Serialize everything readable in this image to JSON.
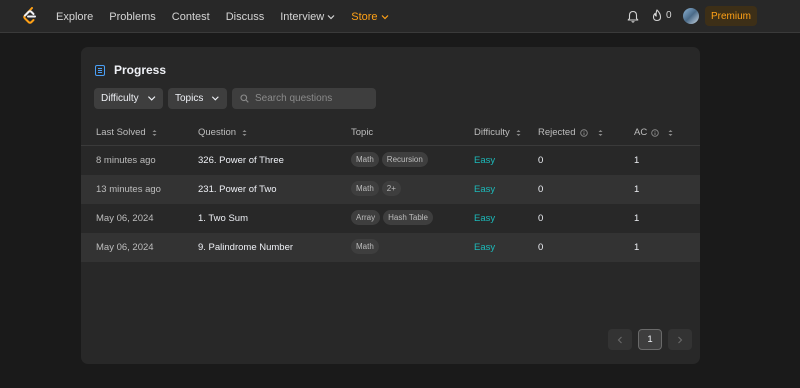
{
  "nav": {
    "links": [
      "Explore",
      "Problems",
      "Contest",
      "Discuss",
      "Interview",
      "Store"
    ],
    "streak_count": "0",
    "premium_label": "Premium"
  },
  "progress": {
    "title": "Progress",
    "filters": {
      "difficulty": "Difficulty",
      "topics": "Topics"
    },
    "search_placeholder": "Search questions",
    "columns": [
      "Last Solved",
      "Question",
      "Topic",
      "Difficulty",
      "Rejected",
      "AC"
    ],
    "rows": [
      {
        "last_solved": "8 minutes ago",
        "question": "326. Power of Three",
        "topics": [
          "Math",
          "Recursion"
        ],
        "difficulty": "Easy",
        "rejected": "0",
        "ac": "1"
      },
      {
        "last_solved": "13 minutes ago",
        "question": "231. Power of Two",
        "topics": [
          "Math",
          "2+"
        ],
        "difficulty": "Easy",
        "rejected": "0",
        "ac": "1"
      },
      {
        "last_solved": "May 06, 2024",
        "question": "1. Two Sum",
        "topics": [
          "Array",
          "Hash Table"
        ],
        "difficulty": "Easy",
        "rejected": "0",
        "ac": "1"
      },
      {
        "last_solved": "May 06, 2024",
        "question": "9. Palindrome Number",
        "topics": [
          "Math"
        ],
        "difficulty": "Easy",
        "rejected": "0",
        "ac": "1"
      }
    ],
    "pagination": {
      "current_page": "1"
    }
  },
  "colors": {
    "accent": "#ffa116",
    "easy": "#1cbaba",
    "background": "#1a1a1a",
    "card": "#282828"
  }
}
